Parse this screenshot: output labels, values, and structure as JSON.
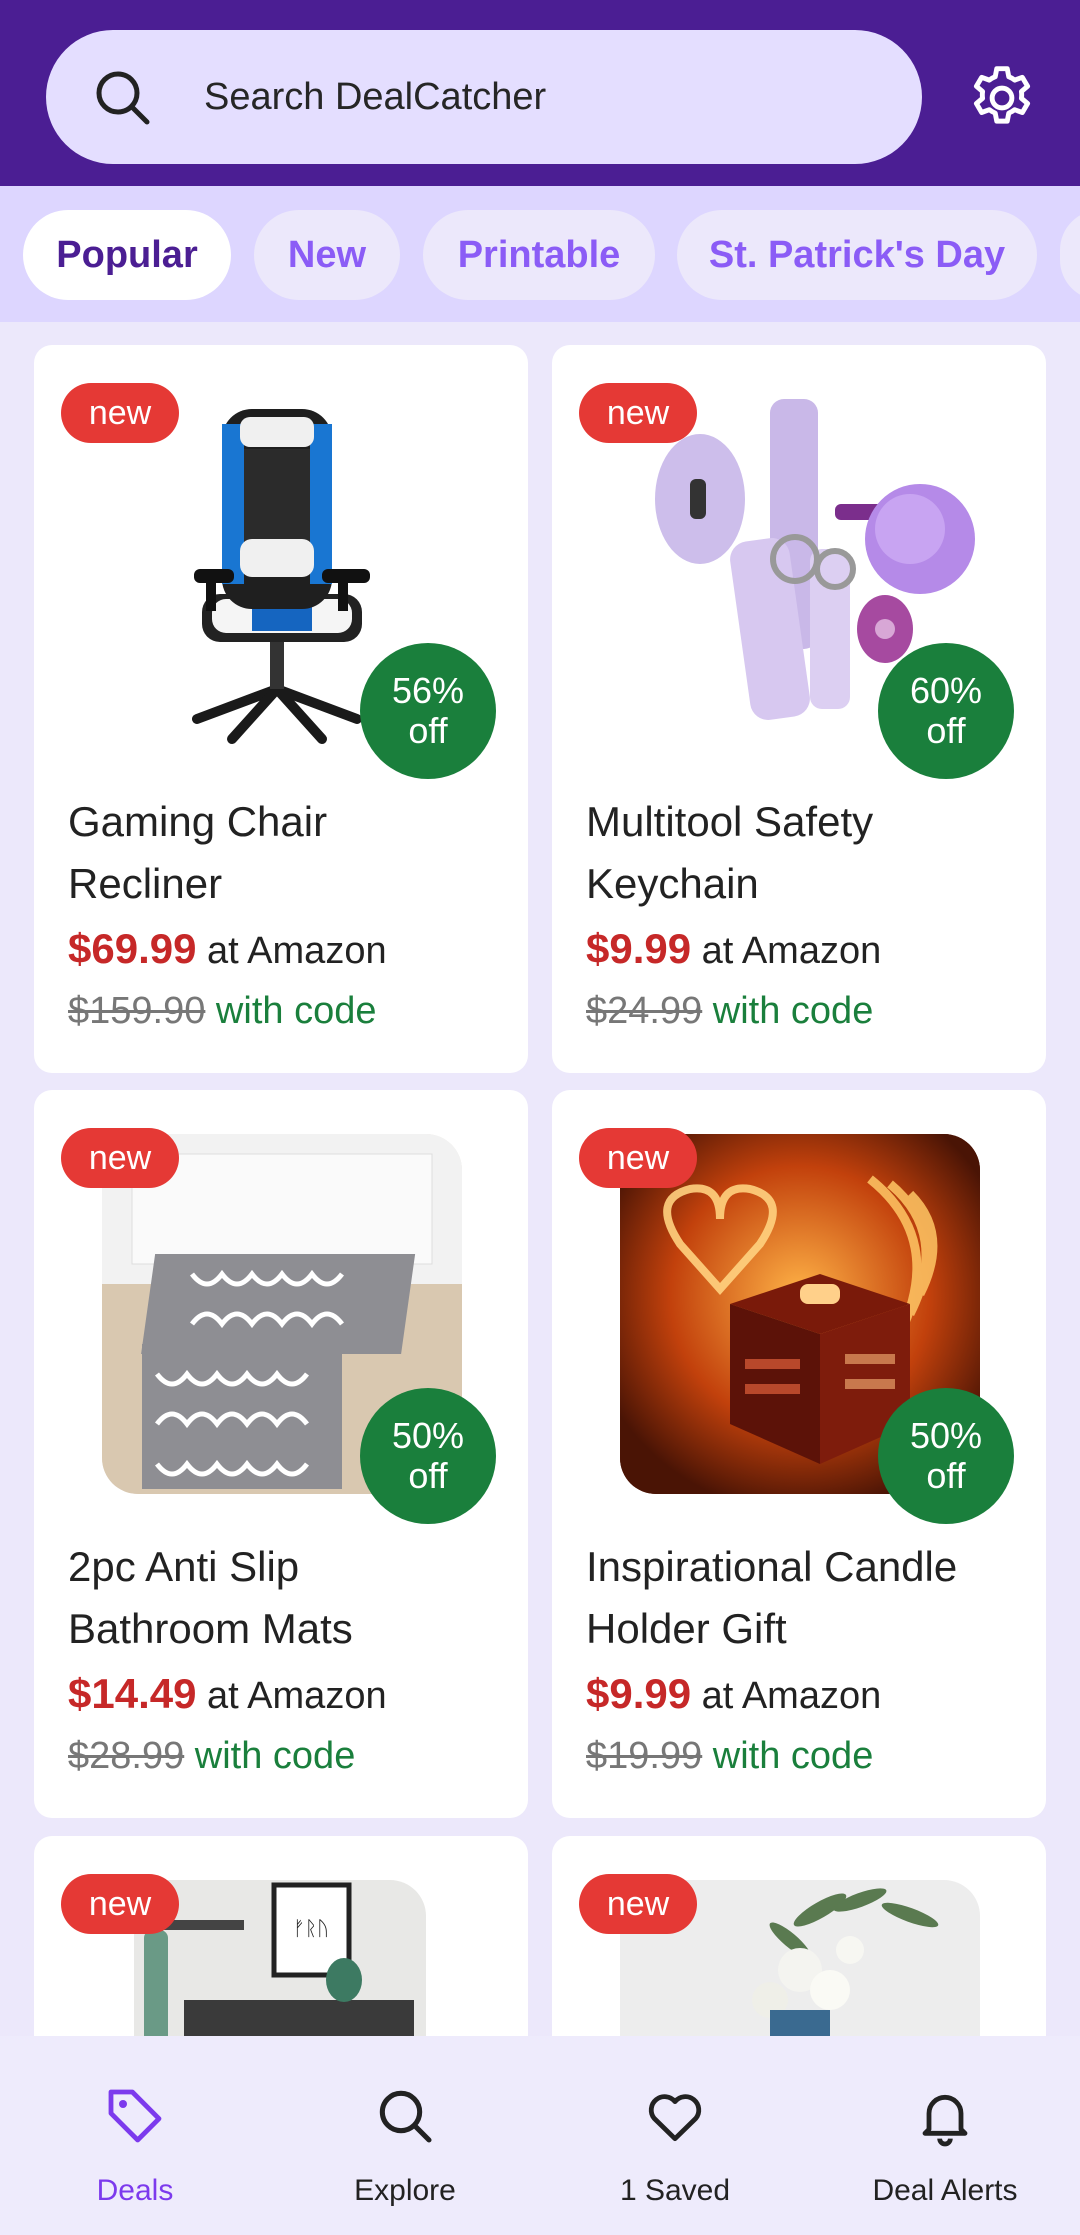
{
  "search": {
    "placeholder": "Search DealCatcher"
  },
  "tabs": [
    {
      "label": "Popular"
    },
    {
      "label": "New"
    },
    {
      "label": "Printable"
    },
    {
      "label": "St. Patrick's Day"
    }
  ],
  "cards": [
    {
      "badge": "new",
      "discount_line1": "56%",
      "discount_line2": "off",
      "title_line1": "Gaming Chair",
      "title_line2": "Recliner",
      "price": "$69.99",
      "store": " at Amazon",
      "old_price": "$159.90",
      "code_label": " with code"
    },
    {
      "badge": "new",
      "discount_line1": "60%",
      "discount_line2": "off",
      "title_line1": "Multitool Safety",
      "title_line2": "Keychain",
      "price": "$9.99",
      "store": " at Amazon",
      "old_price": "$24.99",
      "code_label": " with code"
    },
    {
      "badge": "new",
      "discount_line1": "50%",
      "discount_line2": "off",
      "title_line1": "2pc Anti Slip",
      "title_line2": "Bathroom Mats",
      "price": "$14.49",
      "store": " at Amazon",
      "old_price": "$28.99",
      "code_label": " with code"
    },
    {
      "badge": "new",
      "discount_line1": "50%",
      "discount_line2": "off",
      "title_line1": "Inspirational Candle",
      "title_line2": "Holder Gift",
      "price": "$9.99",
      "store": " at Amazon",
      "old_price": "$19.99",
      "code_label": " with code"
    },
    {
      "badge": "new"
    },
    {
      "badge": "new"
    }
  ],
  "nav": [
    {
      "label": "Deals",
      "icon": "tag-icon"
    },
    {
      "label": "Explore",
      "icon": "search-icon"
    },
    {
      "label": "1 Saved",
      "icon": "heart-icon"
    },
    {
      "label": "Deal Alerts",
      "icon": "bell-icon"
    }
  ],
  "colors": {
    "header": "#4B1E93",
    "accent": "#7C3AED",
    "discount_badge": "#1A7F3C",
    "new_badge": "#E53935",
    "price": "#C62828"
  }
}
